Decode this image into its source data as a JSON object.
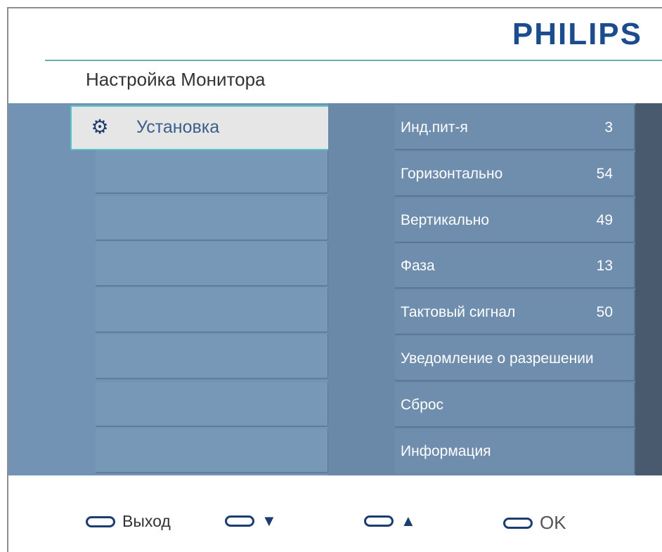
{
  "brand": "PHILIPS",
  "page_title": "Настройка Монитора",
  "left_menu": {
    "selected": {
      "label": "Установка",
      "icon": "gear-icon"
    },
    "empty_rows": 6
  },
  "settings": [
    {
      "label": "Инд.пит-я",
      "value": "3"
    },
    {
      "label": "Горизонтально",
      "value": "54"
    },
    {
      "label": "Вертикально",
      "value": "49"
    },
    {
      "label": "Фаза",
      "value": "13"
    },
    {
      "label": "Тактовый сигнал",
      "value": "50"
    },
    {
      "label": "Уведомление о разрешении",
      "value": ""
    },
    {
      "label": "Сброс",
      "value": ""
    },
    {
      "label": "Информация",
      "value": ""
    }
  ],
  "footer": {
    "exit_label": "Выход",
    "down_symbol": "▼",
    "up_symbol": "▲",
    "ok_label": "OK"
  },
  "colors": {
    "brand": "#1b4d8e",
    "menu_bg": "#7293b3",
    "selected_border": "#58c3c9"
  }
}
